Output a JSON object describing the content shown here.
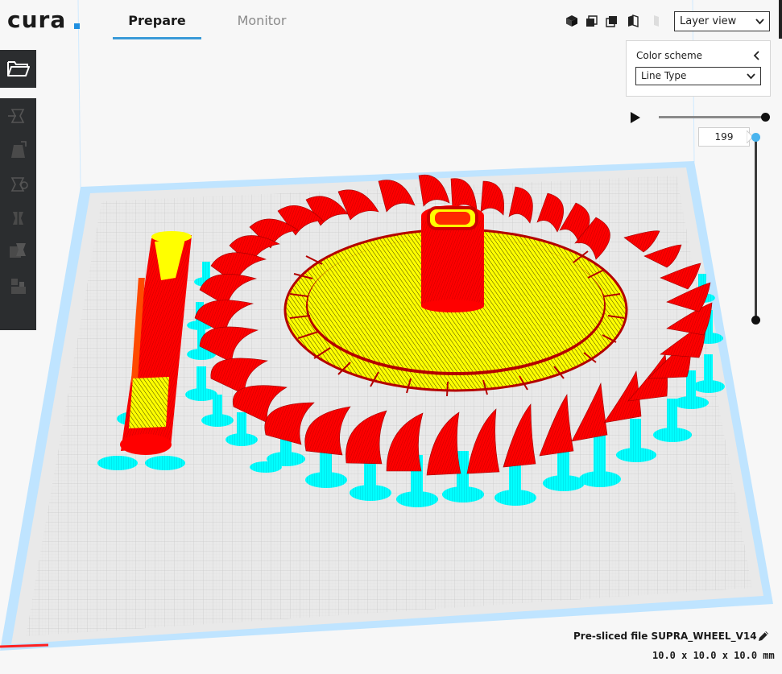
{
  "app": {
    "logo_text": "cura"
  },
  "tabs": [
    {
      "label": "Prepare",
      "active": true
    },
    {
      "label": "Monitor",
      "active": false
    }
  ],
  "view_toolbar": {
    "icons": [
      "3d-view-icon",
      "front-view-icon",
      "top-view-icon",
      "left-view-icon",
      "right-view-icon"
    ],
    "view_mode": "Layer view"
  },
  "color_scheme_panel": {
    "title": "Color scheme",
    "selected": "Line Type"
  },
  "layer_slider": {
    "current_layer": "199"
  },
  "left_toolbar": {
    "icons": [
      "open-file-icon",
      "move-tool-icon",
      "scale-tool-icon",
      "rotate-tool-icon",
      "mirror-tool-icon",
      "per-model-settings-icon",
      "support-blocker-icon"
    ]
  },
  "file": {
    "label": "Pre-sliced file SUPRA_WHEEL_V14",
    "dimensions": "10.0 x 10.0 x 10.0 mm"
  },
  "colors": {
    "wall": "#ff0000",
    "infill": "#ffff00",
    "support": "#00ffff",
    "accent": "#3a9ad8",
    "buildplate": "#e6e6e6"
  }
}
